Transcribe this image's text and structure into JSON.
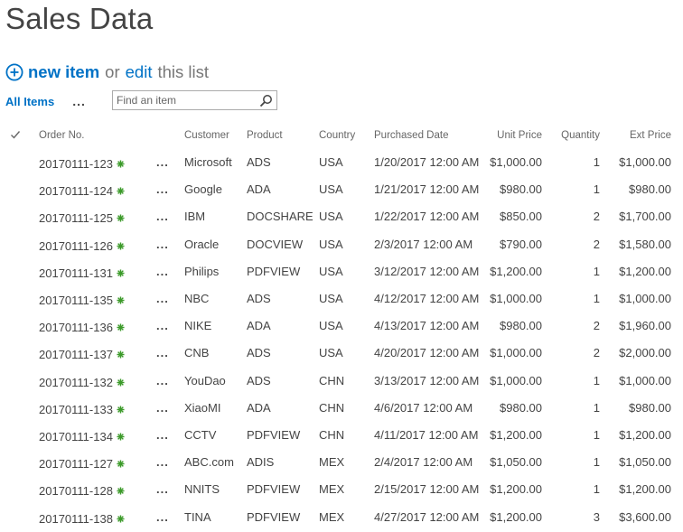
{
  "page": {
    "title": "Sales Data"
  },
  "commands": {
    "new_item_label": "new item",
    "or_text": "or",
    "edit_label": "edit",
    "this_list_text": "this list"
  },
  "view": {
    "current": "All Items",
    "more_label": "..."
  },
  "search": {
    "placeholder": "Find an item"
  },
  "colors": {
    "link": "#0072c6",
    "text": "#444444",
    "header_text": "#666666",
    "new_badge": "#3c9a2a"
  },
  "icons": {
    "add": "add-circle-icon",
    "search": "search-icon",
    "check": "checkmark-icon",
    "new": "new-item-badge-icon"
  },
  "table": {
    "headers": {
      "order_no": "Order No.",
      "customer": "Customer",
      "product": "Product",
      "country": "Country",
      "purchased_date": "Purchased Date",
      "unit_price": "Unit Price",
      "quantity": "Quantity",
      "ext_price": "Ext Price"
    },
    "row_menu_label": "...",
    "rows": [
      {
        "order_no": "20170111-123",
        "customer": "Microsoft",
        "product": "ADS",
        "country": "USA",
        "purchased_date": "1/20/2017 12:00 AM",
        "unit_price": "$1,000.00",
        "quantity": "1",
        "ext_price": "$1,000.00"
      },
      {
        "order_no": "20170111-124",
        "customer": "Google",
        "product": "ADA",
        "country": "USA",
        "purchased_date": "1/21/2017 12:00 AM",
        "unit_price": "$980.00",
        "quantity": "1",
        "ext_price": "$980.00"
      },
      {
        "order_no": "20170111-125",
        "customer": "IBM",
        "product": "DOCSHARE",
        "country": "USA",
        "purchased_date": "1/22/2017 12:00 AM",
        "unit_price": "$850.00",
        "quantity": "2",
        "ext_price": "$1,700.00"
      },
      {
        "order_no": "20170111-126",
        "customer": "Oracle",
        "product": "DOCVIEW",
        "country": "USA",
        "purchased_date": "2/3/2017 12:00 AM",
        "unit_price": "$790.00",
        "quantity": "2",
        "ext_price": "$1,580.00"
      },
      {
        "order_no": "20170111-131",
        "customer": "Philips",
        "product": "PDFVIEW",
        "country": "USA",
        "purchased_date": "3/12/2017 12:00 AM",
        "unit_price": "$1,200.00",
        "quantity": "1",
        "ext_price": "$1,200.00"
      },
      {
        "order_no": "20170111-135",
        "customer": "NBC",
        "product": "ADS",
        "country": "USA",
        "purchased_date": "4/12/2017 12:00 AM",
        "unit_price": "$1,000.00",
        "quantity": "1",
        "ext_price": "$1,000.00"
      },
      {
        "order_no": "20170111-136",
        "customer": "NIKE",
        "product": "ADA",
        "country": "USA",
        "purchased_date": "4/13/2017 12:00 AM",
        "unit_price": "$980.00",
        "quantity": "2",
        "ext_price": "$1,960.00"
      },
      {
        "order_no": "20170111-137",
        "customer": "CNB",
        "product": "ADS",
        "country": "USA",
        "purchased_date": "4/20/2017 12:00 AM",
        "unit_price": "$1,000.00",
        "quantity": "2",
        "ext_price": "$2,000.00"
      },
      {
        "order_no": "20170111-132",
        "customer": "YouDao",
        "product": "ADS",
        "country": "CHN",
        "purchased_date": "3/13/2017 12:00 AM",
        "unit_price": "$1,000.00",
        "quantity": "1",
        "ext_price": "$1,000.00"
      },
      {
        "order_no": "20170111-133",
        "customer": "XiaoMI",
        "product": "ADA",
        "country": "CHN",
        "purchased_date": "4/6/2017 12:00 AM",
        "unit_price": "$980.00",
        "quantity": "1",
        "ext_price": "$980.00"
      },
      {
        "order_no": "20170111-134",
        "customer": "CCTV",
        "product": "PDFVIEW",
        "country": "CHN",
        "purchased_date": "4/11/2017 12:00 AM",
        "unit_price": "$1,200.00",
        "quantity": "1",
        "ext_price": "$1,200.00"
      },
      {
        "order_no": "20170111-127",
        "customer": "ABC.com",
        "product": "ADIS",
        "country": "MEX",
        "purchased_date": "2/4/2017 12:00 AM",
        "unit_price": "$1,050.00",
        "quantity": "1",
        "ext_price": "$1,050.00"
      },
      {
        "order_no": "20170111-128",
        "customer": "NNITS",
        "product": "PDFVIEW",
        "country": "MEX",
        "purchased_date": "2/15/2017 12:00 AM",
        "unit_price": "$1,200.00",
        "quantity": "1",
        "ext_price": "$1,200.00"
      },
      {
        "order_no": "20170111-138",
        "customer": "TINA",
        "product": "PDFVIEW",
        "country": "MEX",
        "purchased_date": "4/27/2017 12:00 AM",
        "unit_price": "$1,200.00",
        "quantity": "3",
        "ext_price": "$3,600.00"
      }
    ]
  }
}
